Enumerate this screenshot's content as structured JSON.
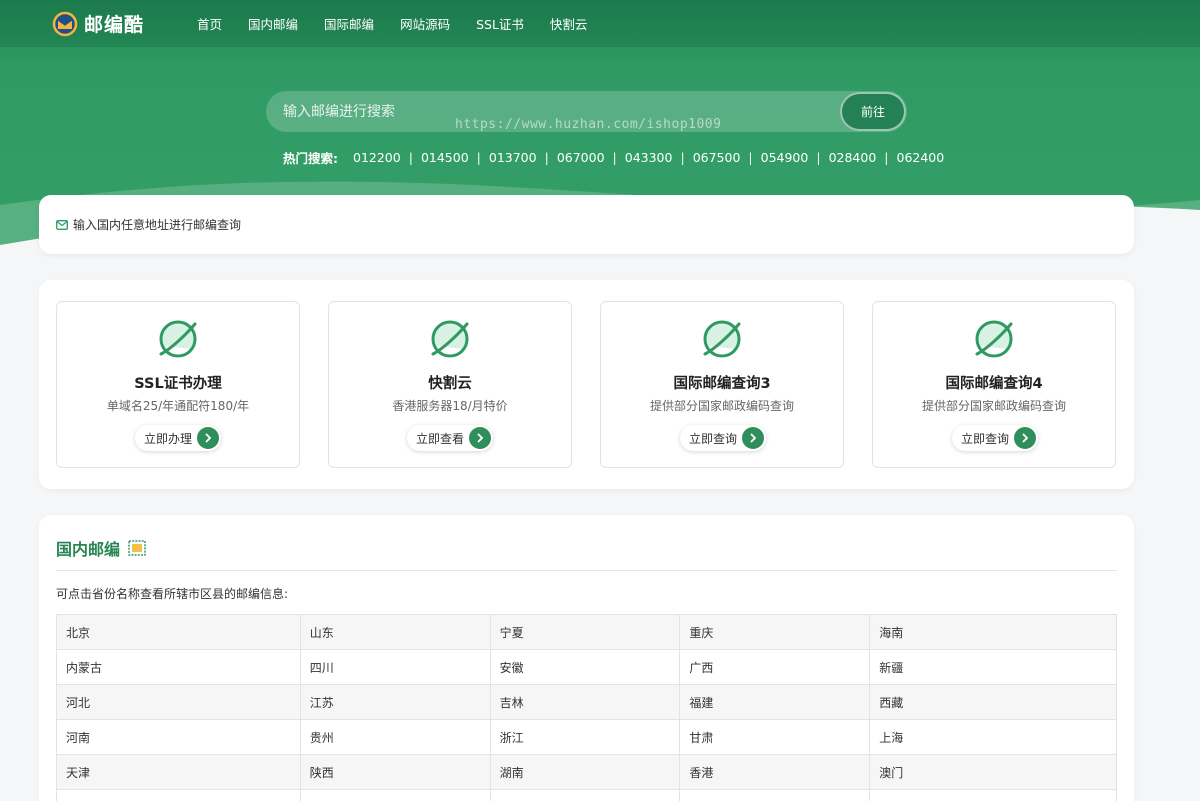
{
  "brand": {
    "name": "邮编酷"
  },
  "nav": {
    "items": [
      "首页",
      "国内邮编",
      "国际邮编",
      "网站源码",
      "SSL证书",
      "快割云"
    ]
  },
  "search": {
    "placeholder": "输入邮编进行搜索",
    "value": "",
    "button_label": "前往",
    "watermark": "https://www.huzhan.com/ishop1009"
  },
  "hot_search": {
    "label": "热门搜索:",
    "codes": [
      "012200",
      "014500",
      "013700",
      "067000",
      "043300",
      "067500",
      "054900",
      "028400",
      "062400"
    ]
  },
  "address_bar": {
    "text": "输入国内任意地址进行邮编查询",
    "icon": "mail-icon"
  },
  "services": [
    {
      "title": "SSL证书办理",
      "desc": "单域名25/年通配符180/年",
      "button": "立即办理",
      "icon": "planet-icon"
    },
    {
      "title": "快割云",
      "desc": "香港服务器18/月特价",
      "button": "立即查看",
      "icon": "planet-icon"
    },
    {
      "title": "国际邮编查询3",
      "desc": "提供部分国家邮政编码查询",
      "button": "立即查询",
      "icon": "planet-icon"
    },
    {
      "title": "国际邮编查询4",
      "desc": "提供部分国家邮政编码查询",
      "button": "立即查询",
      "icon": "planet-icon"
    }
  ],
  "domestic": {
    "title": "国内邮编",
    "note": "可点击省份名称查看所辖市区县的邮编信息:",
    "rows": [
      [
        "北京",
        "山东",
        "宁夏",
        "重庆",
        "海南"
      ],
      [
        "内蒙古",
        "四川",
        "安徽",
        "广西",
        "新疆"
      ],
      [
        "河北",
        "江苏",
        "吉林",
        "福建",
        "西藏"
      ],
      [
        "河南",
        "贵州",
        "浙江",
        "甘肃",
        "上海"
      ],
      [
        "天津",
        "陕西",
        "湖南",
        "香港",
        "澳门"
      ],
      [
        "",
        "",
        "",
        "",
        ""
      ]
    ]
  },
  "colors": {
    "primary": "#2e9a62",
    "dark": "#248155",
    "title_green": "#2b8552"
  }
}
